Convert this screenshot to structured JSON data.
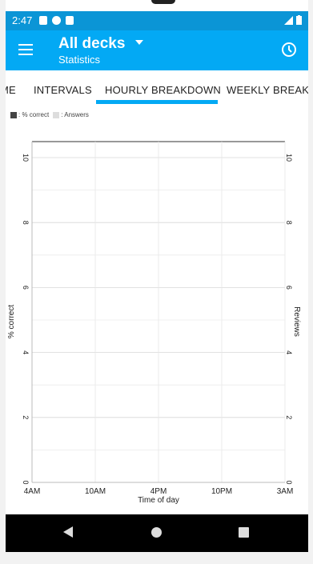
{
  "status_bar": {
    "time": "2:47"
  },
  "app_bar": {
    "title": "All decks",
    "subtitle": "Statistics"
  },
  "tabs": [
    {
      "label": "ME"
    },
    {
      "label": "INTERVALS"
    },
    {
      "label": "HOURLY BREAKDOWN",
      "selected": true
    },
    {
      "label": "WEEKLY BREAKDOWN"
    }
  ],
  "legend": {
    "correct": ": % correct",
    "answers": ": Answers"
  },
  "colors": {
    "app_bar": "#03a9f4",
    "status_bar": "#0b95d6",
    "tab_indicator": "#03a9f4"
  },
  "chart_data": {
    "type": "bar",
    "title": "",
    "xlabel": "Time of day",
    "ylabel": "% correct",
    "y2label": "Reviews",
    "x_tick_labels": [
      "4AM",
      "10AM",
      "4PM",
      "10PM",
      "3AM"
    ],
    "y_tick_labels": [
      "0",
      "2",
      "4",
      "6",
      "8",
      "10"
    ],
    "y2_tick_labels": [
      "0",
      "2",
      "4",
      "6",
      "8",
      "10"
    ],
    "ylim": [
      0,
      10
    ],
    "y2lim": [
      0,
      10
    ],
    "series": [],
    "grid": true,
    "legend": "top-left"
  }
}
